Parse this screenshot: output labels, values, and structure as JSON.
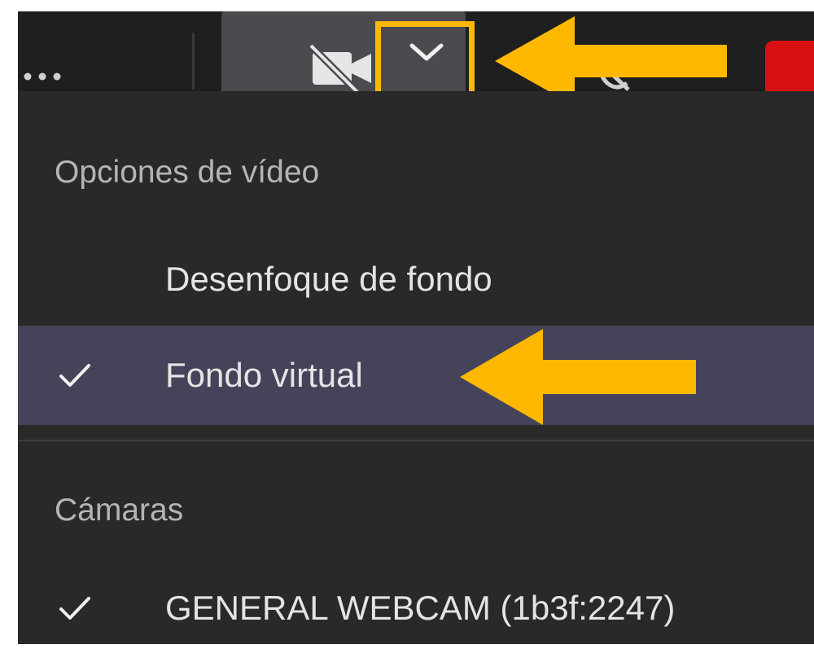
{
  "toolbar": {
    "more_icon": "more-horizontal-icon",
    "camera_icon": "camera-off-icon",
    "dropdown_icon": "chevron-down-icon",
    "mic_icon": "mic-off-icon",
    "hangup_color": "#d71111"
  },
  "menu": {
    "video_options_heading": "Opciones de vídeo",
    "video_items": [
      {
        "label": "Desenfoque de fondo",
        "checked": false
      },
      {
        "label": "Fondo virtual",
        "checked": true
      }
    ],
    "cameras_heading": "Cámaras",
    "camera_items": [
      {
        "label": "GENERAL WEBCAM (1b3f:2247)",
        "checked": true
      }
    ]
  },
  "colors": {
    "annotation": "#ffb800",
    "selected_row": "#444359",
    "menu_background": "#292929"
  }
}
